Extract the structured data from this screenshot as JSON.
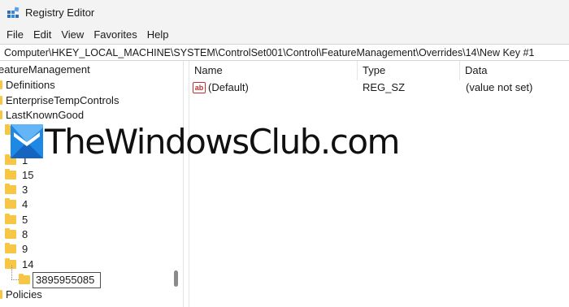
{
  "window": {
    "title": "Registry Editor"
  },
  "menu": [
    "File",
    "Edit",
    "View",
    "Favorites",
    "Help"
  ],
  "address": "Computer\\HKEY_LOCAL_MACHINE\\SYSTEM\\ControlSet001\\Control\\FeatureManagement\\Overrides\\14\\New Key #1",
  "tree": {
    "partial_top": "eatureManagement",
    "items": [
      "Definitions",
      "EnterpriseTempControls",
      "LastKnownGood",
      "0",
      "1",
      "15",
      "3",
      "4",
      "5",
      "8",
      "9",
      "14"
    ],
    "editing_value": "3895955085",
    "after_items": [
      "Policies"
    ]
  },
  "list": {
    "columns": [
      "Name",
      "Type",
      "Data"
    ],
    "rows": [
      {
        "name": "(Default)",
        "type": "REG_SZ",
        "data": "(value not set)",
        "icon": "string-value-icon"
      }
    ]
  },
  "watermark": {
    "text": "TheWindowsClub.com"
  },
  "colors": {
    "folder": "#f7c644",
    "titlebar": "#f3f3f3",
    "logo_blue": "#1e88e5"
  }
}
